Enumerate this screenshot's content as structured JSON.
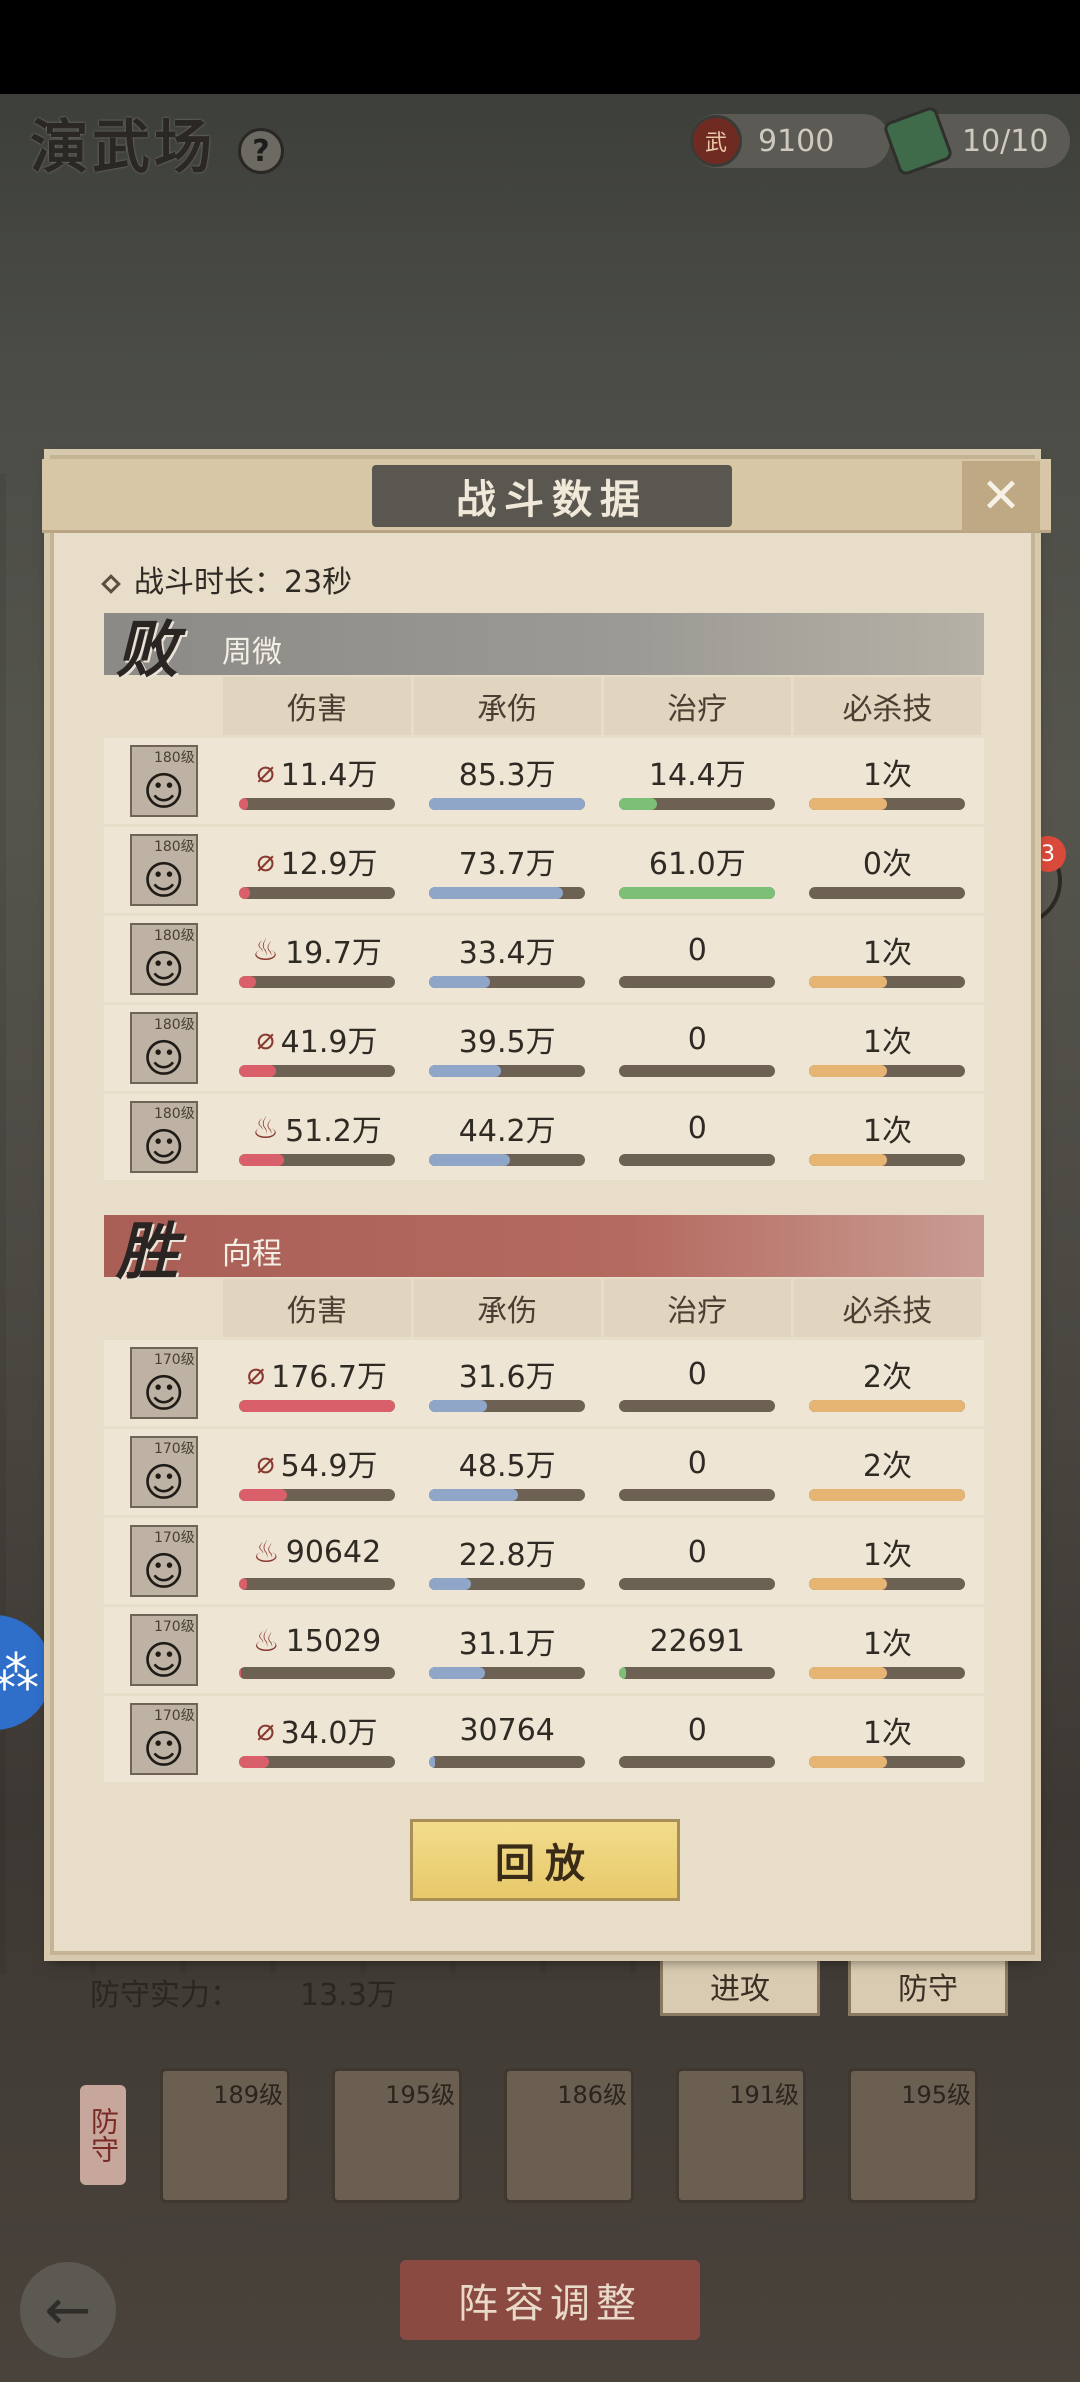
{
  "topbar": {
    "title": "演武场",
    "help": "?",
    "currency_value": "9100",
    "tickets_value": "10/10",
    "currency_glyph": "武"
  },
  "modal": {
    "title": "战斗数据",
    "close": "✕",
    "duration": "战斗时长：23秒",
    "replay": "回放"
  },
  "columns": [
    "伤害",
    "承伤",
    "治疗",
    "必杀技"
  ],
  "teams": [
    {
      "result": "败",
      "name": "周微",
      "rows": [
        {
          "lv": "180级",
          "type": "claw",
          "damage": "11.4万",
          "taken": "85.3万",
          "heal": "14.4万",
          "ult": "1次",
          "dmg_frac": 0.06,
          "taken_frac": 1.0,
          "heal_frac": 0.24,
          "ult_frac": 0.5
        },
        {
          "lv": "180级",
          "type": "claw",
          "damage": "12.9万",
          "taken": "73.7万",
          "heal": "61.0万",
          "ult": "0次",
          "dmg_frac": 0.07,
          "taken_frac": 0.86,
          "heal_frac": 1.0,
          "ult_frac": 0
        },
        {
          "lv": "180级",
          "type": "fire",
          "damage": "19.7万",
          "taken": "33.4万",
          "heal": "0",
          "ult": "1次",
          "dmg_frac": 0.11,
          "taken_frac": 0.39,
          "heal_frac": 0,
          "ult_frac": 0.5
        },
        {
          "lv": "180级",
          "type": "claw",
          "damage": "41.9万",
          "taken": "39.5万",
          "heal": "0",
          "ult": "1次",
          "dmg_frac": 0.24,
          "taken_frac": 0.46,
          "heal_frac": 0,
          "ult_frac": 0.5
        },
        {
          "lv": "180级",
          "type": "fire",
          "damage": "51.2万",
          "taken": "44.2万",
          "heal": "0",
          "ult": "1次",
          "dmg_frac": 0.29,
          "taken_frac": 0.52,
          "heal_frac": 0,
          "ult_frac": 0.5
        }
      ]
    },
    {
      "result": "胜",
      "name": "向程",
      "rows": [
        {
          "lv": "170级",
          "type": "claw",
          "damage": "176.7万",
          "taken": "31.6万",
          "heal": "0",
          "ult": "2次",
          "dmg_frac": 1.0,
          "taken_frac": 0.37,
          "heal_frac": 0,
          "ult_frac": 1.0
        },
        {
          "lv": "170级",
          "type": "claw",
          "damage": "54.9万",
          "taken": "48.5万",
          "heal": "0",
          "ult": "2次",
          "dmg_frac": 0.31,
          "taken_frac": 0.57,
          "heal_frac": 0,
          "ult_frac": 1.0
        },
        {
          "lv": "170级",
          "type": "fire",
          "damage": "90642",
          "taken": "22.8万",
          "heal": "0",
          "ult": "1次",
          "dmg_frac": 0.05,
          "taken_frac": 0.27,
          "heal_frac": 0,
          "ult_frac": 0.5
        },
        {
          "lv": "170级",
          "type": "fire",
          "damage": "15029",
          "taken": "31.1万",
          "heal": "22691",
          "ult": "1次",
          "dmg_frac": 0.01,
          "taken_frac": 0.36,
          "heal_frac": 0.04,
          "ult_frac": 0.5
        },
        {
          "lv": "170级",
          "type": "claw",
          "damage": "34.0万",
          "taken": "30764",
          "heal": "0",
          "ult": "1次",
          "dmg_frac": 0.19,
          "taken_frac": 0.04,
          "heal_frac": 0,
          "ult_frac": 0.5
        }
      ]
    }
  ],
  "background": {
    "defense_label": "防守实力：",
    "defense_value": "13.3万",
    "def_tag": "防守",
    "lineup": "阵容调整",
    "btn_a": "进攻",
    "btn_b": "防守",
    "heroes": [
      "189级",
      "195级",
      "186级",
      "191级",
      "195级"
    ],
    "chat_badge": "3"
  },
  "colors": {
    "damage_bar": "#d9606a",
    "taken_bar": "#8fa6c8",
    "heal_bar": "#7cbf76",
    "ult_bar": "#e6b574"
  }
}
